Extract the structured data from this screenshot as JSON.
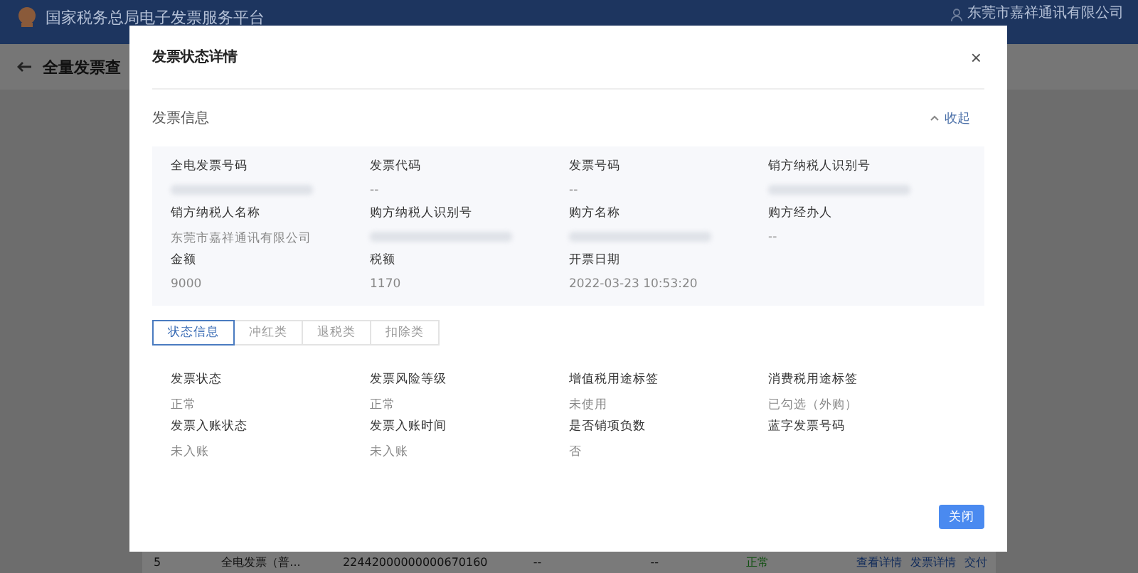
{
  "header": {
    "title": "国家税务总局电子发票服务平台",
    "user": "东莞市嘉祥通讯有限公司"
  },
  "page": {
    "back_title": "全量发票查"
  },
  "table_row": {
    "cells": [
      "5",
      "全电发票（普...",
      "22442000000000670160",
      "--",
      "--",
      "正常"
    ],
    "actions": [
      "查看详情",
      "发票详情",
      "交付"
    ]
  },
  "modal": {
    "title": "发票状态详情",
    "close": "×",
    "section_title": "发票信息",
    "collapse": "收起",
    "invoice_fields": [
      {
        "label": "全电发票号码",
        "redacted": true
      },
      {
        "label": "发票代码",
        "value": "--",
        "redacted": false
      },
      {
        "label": "发票号码",
        "value": "--",
        "redacted": false
      },
      {
        "label": "销方纳税人识别号",
        "redacted": true
      },
      {
        "label": "销方纳税人名称",
        "value": "东莞市嘉祥通讯有限公司",
        "redacted": false
      },
      {
        "label": "购方纳税人识别号",
        "redacted": true
      },
      {
        "label": "购方名称",
        "redacted": true
      },
      {
        "label": "购方经办人",
        "value": "--",
        "redacted": false
      },
      {
        "label": "金额",
        "value": "9000",
        "redacted": false
      },
      {
        "label": "税额",
        "value": "1170",
        "redacted": false
      },
      {
        "label": "开票日期",
        "value": "2022-03-23 10:53:20",
        "redacted": false
      }
    ],
    "tabs": [
      {
        "label": "状态信息",
        "selected": true
      },
      {
        "label": "冲红类",
        "selected": false
      },
      {
        "label": "退税类",
        "selected": false
      },
      {
        "label": "扣除类",
        "selected": false
      }
    ],
    "status_fields": [
      {
        "label": "发票状态",
        "value": "正常"
      },
      {
        "label": "发票风险等级",
        "value": "正常"
      },
      {
        "label": "增值税用途标签",
        "value": "未使用"
      },
      {
        "label": "消费税用途标签",
        "value": "已勾选（外购）"
      },
      {
        "label": "发票入账状态",
        "value": "未入账"
      },
      {
        "label": "发票入账时间",
        "value": "未入账"
      },
      {
        "label": "是否销项负数",
        "value": "否"
      },
      {
        "label": "蓝字发票号码"
      }
    ],
    "button": "关闭"
  }
}
